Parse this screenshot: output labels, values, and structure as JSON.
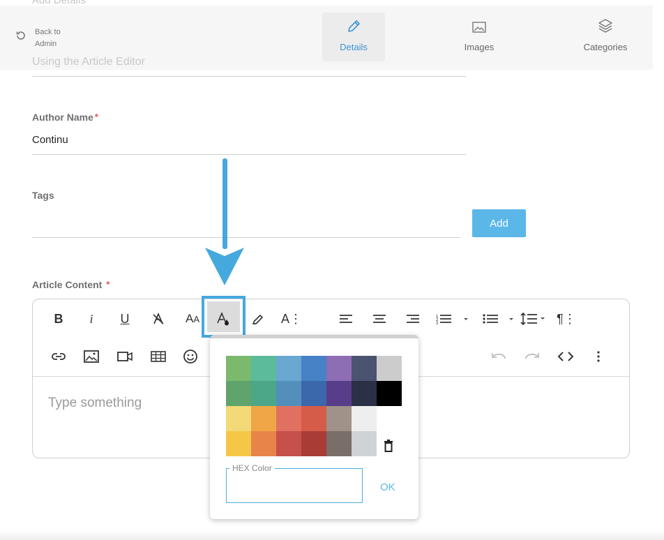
{
  "header": {
    "ghost_top": "Add Details",
    "back_label": "Back to Admin",
    "tabs": [
      {
        "label": "Details",
        "icon": "pencil-icon",
        "active": true
      },
      {
        "label": "Images",
        "icon": "image-icon",
        "active": false
      },
      {
        "label": "Categories",
        "icon": "layers-icon",
        "active": false
      }
    ],
    "ghost_subtitle": "Using the Article Editor"
  },
  "form": {
    "author_label": "Author Name",
    "author_value": "Continu",
    "tags_label": "Tags",
    "add_label": "Add",
    "content_label": "Article Content",
    "required_mark": "*"
  },
  "editor": {
    "placeholder": "Type something",
    "toolbar_row1": [
      "bold",
      "italic",
      "underline",
      "clear-format",
      "font-size",
      "text-color",
      "highlight",
      "font-family",
      "align-left",
      "align-center",
      "align-right",
      "ordered-list",
      "unordered-list",
      "line-height",
      "paragraph-style"
    ],
    "toolbar_row2": [
      "link",
      "image",
      "video",
      "table",
      "emoji",
      "undo",
      "redo",
      "code-view",
      "more"
    ]
  },
  "color_popup": {
    "hex_label": "HEX Color",
    "hex_value": "",
    "ok_label": "OK",
    "swatches": [
      [
        "#7bb96d",
        "#5bbb9b",
        "#6aa7d1",
        "#4781c6",
        "#8e6cb6",
        "#4a5370",
        "#cccccc"
      ],
      [
        "#5fa46c",
        "#4ba788",
        "#528fba",
        "#3b67ab",
        "#573d8a",
        "#2b3046",
        "#000000"
      ],
      [
        "#f3d977",
        "#f0a646",
        "#e07060",
        "#d55c48",
        "#a09288",
        "#eeeeee"
      ],
      [
        "#f4c846",
        "#e8844a",
        "#c6504a",
        "#aa3c36",
        "#7a6e68",
        "#d0d3d6"
      ]
    ]
  },
  "colors": {
    "accent": "#45a9dd",
    "button": "#5bb7e8",
    "required": "#e05a4b"
  }
}
